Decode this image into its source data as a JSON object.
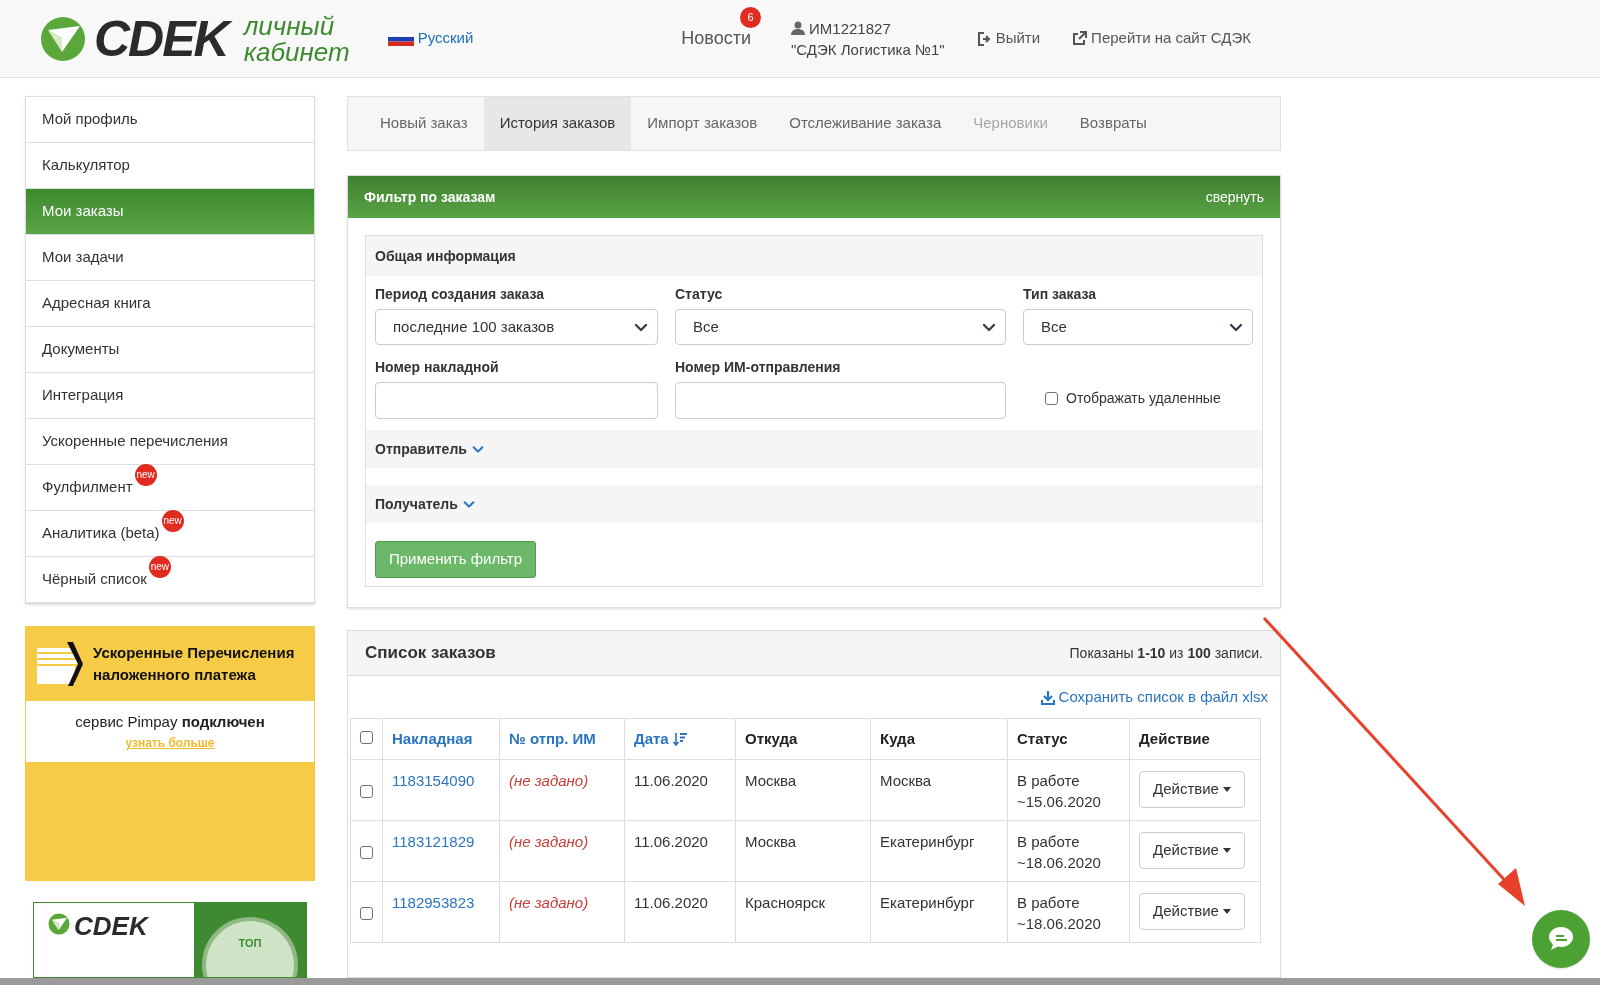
{
  "header": {
    "logo": "CDEK",
    "subtitle": "личный кабинет",
    "language": "Русский",
    "news": {
      "label": "Новости",
      "count": "6"
    },
    "user": {
      "id": "ИМ1221827",
      "company": "\"СДЭК Логистика №1\""
    },
    "logout": "Выйти",
    "site_link": "Перейти на сайт СДЭК"
  },
  "sidebar": {
    "items": [
      {
        "label": "Мой профиль",
        "selected": false
      },
      {
        "label": "Калькулятор",
        "selected": false
      },
      {
        "label": "Мои заказы",
        "selected": true
      },
      {
        "label": "Мои задачи",
        "selected": false
      },
      {
        "label": "Адресная книга",
        "selected": false
      },
      {
        "label": "Документы",
        "selected": false
      },
      {
        "label": "Интеграция",
        "selected": false
      },
      {
        "label": "Ускоренные перечисления",
        "selected": false
      },
      {
        "label": "Фулфилмент",
        "selected": false,
        "badge": "new"
      },
      {
        "label": "Аналитика (beta)",
        "selected": false,
        "badge": "new"
      },
      {
        "label": "Чёрный список",
        "selected": false,
        "badge": "new"
      }
    ]
  },
  "promo": {
    "title": "Ускоренные Перечисления наложенного платежа",
    "status": "сервис Pimpay **подключен**",
    "link": "узнать больше"
  },
  "promo2": {
    "logo": "CDEK",
    "seal": "ТОП"
  },
  "tabs": [
    {
      "label": "Новый заказ",
      "selected": false,
      "disabled": false
    },
    {
      "label": "История заказов",
      "selected": true,
      "disabled": false
    },
    {
      "label": "Импорт заказов",
      "selected": false,
      "disabled": false
    },
    {
      "label": "Отслеживание заказа",
      "selected": false,
      "disabled": false
    },
    {
      "label": "Черновики",
      "selected": false,
      "disabled": true
    },
    {
      "label": "Возвраты",
      "selected": false,
      "disabled": false
    }
  ],
  "filter": {
    "title": "Фильтр по заказам",
    "collapse": "свернуть",
    "section": "Общая информация",
    "fields": [
      {
        "kind": "select",
        "label": "Период создания заказа",
        "value": "последние 100 заказов"
      },
      {
        "kind": "select",
        "label": "Статус",
        "value": "Все"
      },
      {
        "kind": "select",
        "label": "Тип заказа",
        "value": "Все"
      },
      {
        "kind": "input",
        "label": "Номер накладной"
      },
      {
        "kind": "input",
        "label": "Номер ИМ-отправления"
      },
      {
        "kind": "checkbox",
        "label": "Отображать удаленные",
        "checked": false
      }
    ],
    "groups": [
      {
        "label": "Отправитель",
        "expanded": false
      },
      {
        "label": "Получатель",
        "expanded": false
      }
    ],
    "apply": "Применить фильтр"
  },
  "orders": {
    "title": "Список заказов",
    "summary": "Показаны **1-10** из **100** записи.",
    "export": "Сохранить список в файл xlsx",
    "select_all": {
      "checked": false
    },
    "columns": [
      {
        "label": "Накладная",
        "link": true
      },
      {
        "label": "№ отпр. ИМ",
        "link": true
      },
      {
        "label": "Дата",
        "link": true,
        "sorted": true
      },
      {
        "label": "Откуда",
        "link": false
      },
      {
        "label": "Куда",
        "link": false
      },
      {
        "label": "Статус",
        "link": false
      },
      {
        "label": "Действие",
        "link": false
      }
    ],
    "rows": [
      {
        "checked": false,
        "waybill": "1183154090",
        "im_number": "(не задано)",
        "date": "11.06.2020",
        "from": "Москва",
        "to": "Москва",
        "status": "В работе ~15.06.2020",
        "action": "Действие"
      },
      {
        "checked": false,
        "waybill": "1183121829",
        "im_number": "(не задано)",
        "date": "11.06.2020",
        "from": "Москва",
        "to": "Екатеринбург",
        "status": "В работе ~18.06.2020",
        "action": "Действие"
      },
      {
        "checked": false,
        "waybill": "1182953823",
        "im_number": "(не задано)",
        "date": "11.06.2020",
        "from": "Красноярск",
        "to": "Екатеринбург",
        "status": "В работе ~18.06.2020",
        "action": "Действие"
      }
    ]
  }
}
